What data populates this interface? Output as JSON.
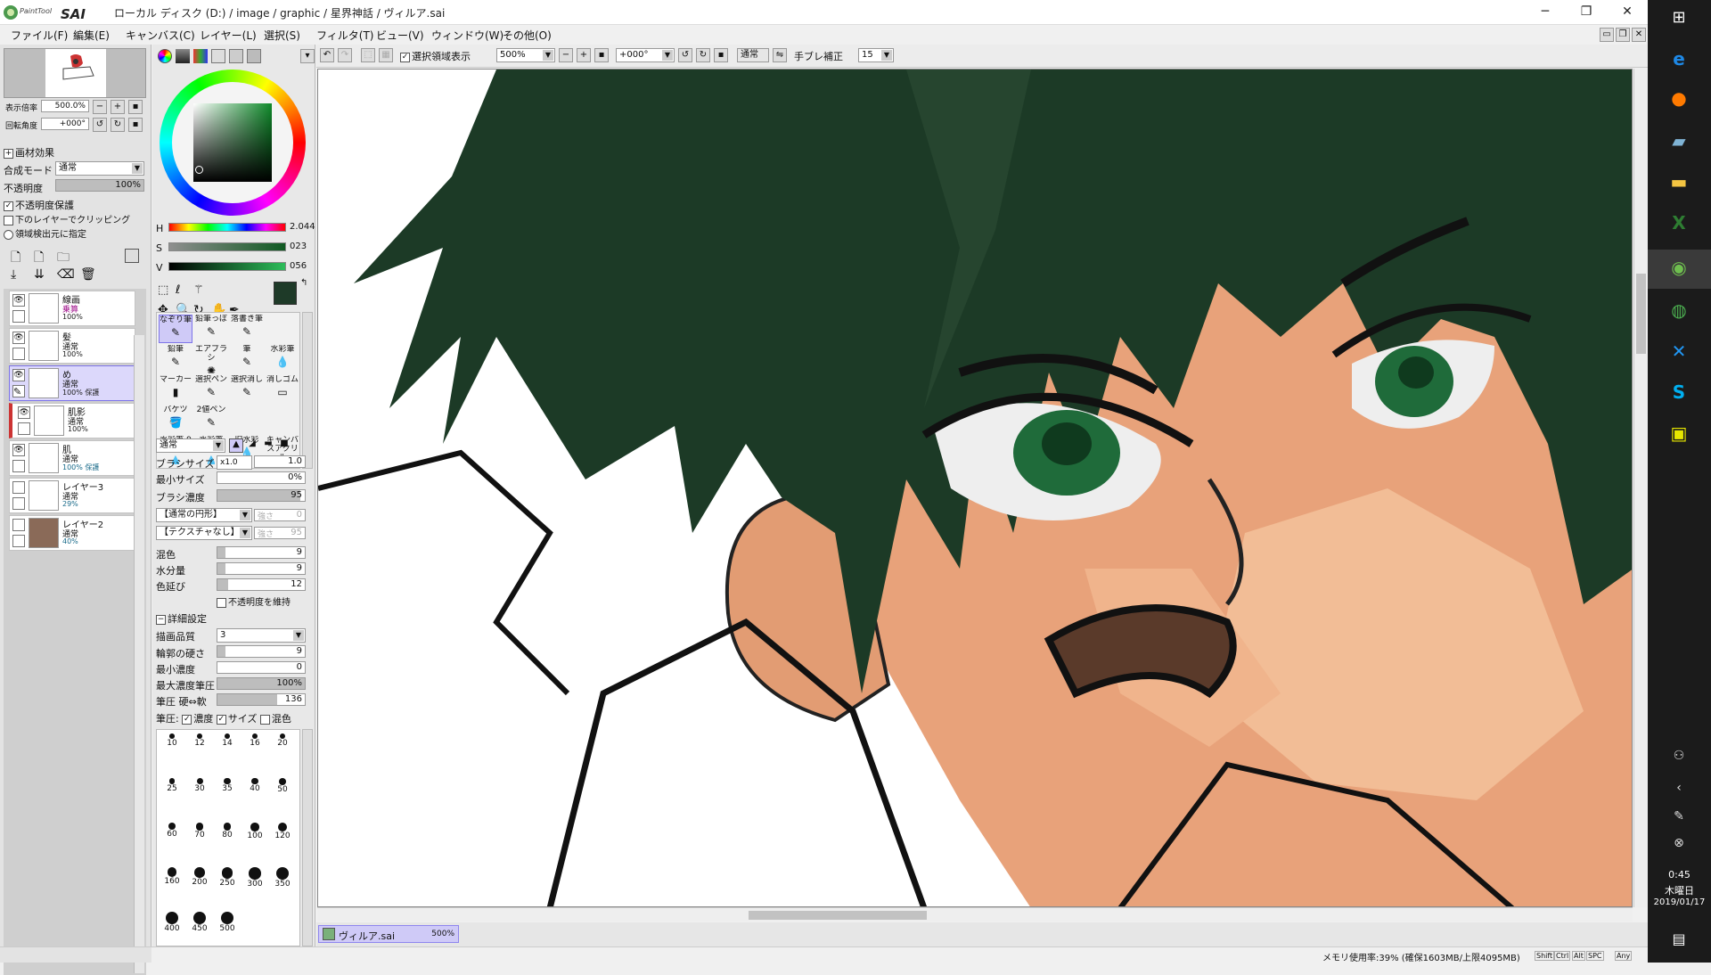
{
  "app": {
    "logo_text": "PaintTool SAI",
    "title": "ローカル ディスク (D:) / image / graphic / 星界神話 / ヴィルア.sai",
    "win_min": "─",
    "win_max": "❐",
    "win_close": "✕"
  },
  "menu": [
    "ファイル(F)",
    "編集(E)",
    "キャンバス(C)",
    "レイヤー(L)",
    "選択(S)",
    "フィルタ(T)",
    "ビュー(V)",
    "ウィンドウ(W)",
    "その他(O)"
  ],
  "nav": {
    "zoom_label": "表示倍率",
    "zoom_value": "500.0%",
    "rotate_label": "回転角度",
    "rotate_value": "+000°"
  },
  "layer_props": {
    "effects_label": "画材効果",
    "blend_label": "合成モード",
    "blend_value": "通常",
    "opacity_label": "不透明度",
    "opacity_value": "100%",
    "preserve_opacity": "不透明度保護",
    "clip_lower": "下のレイヤーでクリッピング",
    "select_source": "領域検出元に指定"
  },
  "layers": [
    {
      "name": "線画",
      "mode": "乗算",
      "opacity": "100%",
      "visible": true,
      "selected": false
    },
    {
      "name": "髪",
      "mode": "通常",
      "opacity": "100%",
      "visible": true,
      "selected": false
    },
    {
      "name": "め",
      "mode": "通常",
      "opacity": "100% 保護",
      "visible": true,
      "selected": true
    },
    {
      "name": "肌影",
      "mode": "通常",
      "opacity": "100%",
      "visible": true,
      "selected": false
    },
    {
      "name": "肌",
      "mode": "通常",
      "opacity": "100% 保護",
      "visible": true,
      "selected": false
    },
    {
      "name": "レイヤー3",
      "mode": "通常",
      "opacity": "29%",
      "visible": false,
      "selected": false
    },
    {
      "name": "レイヤー2",
      "mode": "通常",
      "opacity": "40%",
      "visible": false,
      "selected": false
    }
  ],
  "color": {
    "h_label": "H",
    "h_value": "2.044",
    "s_label": "S",
    "s_value": "023",
    "v_label": "V",
    "v_value": "056",
    "primary": "#1e3a28",
    "secondary": "#d9d37a"
  },
  "tools": [
    {
      "name": "なぞり筆"
    },
    {
      "name": "鉛筆っぽ"
    },
    {
      "name": "落書き筆"
    },
    {
      "name": ""
    },
    {
      "name": "鉛筆"
    },
    {
      "name": "エアブラシ"
    },
    {
      "name": "筆"
    },
    {
      "name": "水彩筆"
    },
    {
      "name": "マーカー"
    },
    {
      "name": "選択ペン"
    },
    {
      "name": "選択消し"
    },
    {
      "name": "消しゴム"
    },
    {
      "name": "バケツ"
    },
    {
      "name": "2値ペン"
    },
    {
      "name": ""
    },
    {
      "name": ""
    },
    {
      "name": "水彩筆 9鋭"
    },
    {
      "name": "水彩筆 10鋭"
    },
    {
      "name": "旧水彩"
    },
    {
      "name": "キャンバスアクリル"
    }
  ],
  "brush": {
    "mode": "通常",
    "size_label": "ブラシサイズ",
    "size_mult": "x1.0",
    "size_value": "1.0",
    "min_size_label": "最小サイズ",
    "min_size_value": "0%",
    "density_label": "ブラシ濃度",
    "density_value": "95",
    "shape": "【通常の円形】",
    "shape_value": "強さ",
    "shape_num": "0",
    "texture": "【テクスチャなし】",
    "texture_value": "強さ",
    "texture_num": "95",
    "blend_label": "混色",
    "blend_value": "9",
    "water_label": "水分量",
    "water_value": "9",
    "stretch_label": "色延び",
    "stretch_value": "12",
    "keep_opacity": "不透明度を維持",
    "detail_label": "詳細設定",
    "quality_label": "描画品質",
    "quality_value": "3",
    "hardness_label": "輪郭の硬さ",
    "hardness_value": "9",
    "min_density_label": "最小濃度",
    "min_density_value": "0",
    "max_pressure_label": "最大濃度筆圧",
    "max_pressure_value": "100%",
    "pressure_label": "筆圧 硬⇔軟",
    "pressure_value": "136",
    "pressure_opts_label": "筆圧:",
    "opt_density": "濃度",
    "opt_size": "サイズ",
    "opt_blend": "混色"
  },
  "brush_sizes": [
    "10",
    "12",
    "14",
    "16",
    "20",
    "25",
    "30",
    "35",
    "40",
    "50",
    "60",
    "70",
    "80",
    "100",
    "120",
    "160",
    "200",
    "250",
    "300",
    "350",
    "400",
    "450",
    "500"
  ],
  "toolbar": {
    "show_selection": "選択領域表示",
    "zoom": "500%",
    "angle": "+000°",
    "blend": "通常",
    "stabilizer_label": "手ブレ補正",
    "stabilizer_value": "15"
  },
  "doc_tab": {
    "name": "ヴィルア.sai",
    "zoom": "500%"
  },
  "status": {
    "memory": "メモリ使用率:39% (確保1603MB/上限4095MB)",
    "keys": [
      "Shift",
      "Ctrl",
      "Alt",
      "SPC",
      "Any"
    ]
  },
  "taskbar": {
    "time": "0:45",
    "weekday": "木曜日",
    "date": "2019/01/17"
  }
}
